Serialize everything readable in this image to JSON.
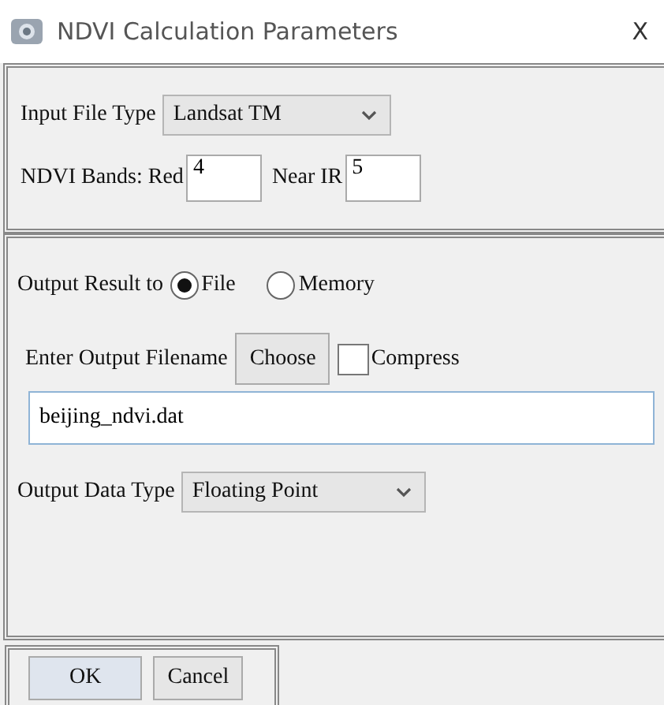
{
  "window": {
    "title": "NDVI Calculation Parameters",
    "close": "X"
  },
  "input_file_type": {
    "label": "Input File Type",
    "value": "Landsat TM"
  },
  "ndvi_bands": {
    "label": "NDVI Bands: Red",
    "red": "4",
    "near_ir_label": "Near IR",
    "near_ir": "5"
  },
  "output_result": {
    "label": "Output Result to",
    "options": [
      {
        "label": "File",
        "selected": true
      },
      {
        "label": "Memory",
        "selected": false
      }
    ]
  },
  "output_filename": {
    "label": "Enter Output Filename",
    "choose_button": "Choose",
    "compress": {
      "label": "Compress",
      "checked": false
    },
    "value": "beijing_ndvi.dat"
  },
  "output_data_type": {
    "label": "Output Data Type",
    "value": "Floating Point"
  },
  "buttons": [
    "OK",
    "Cancel"
  ]
}
